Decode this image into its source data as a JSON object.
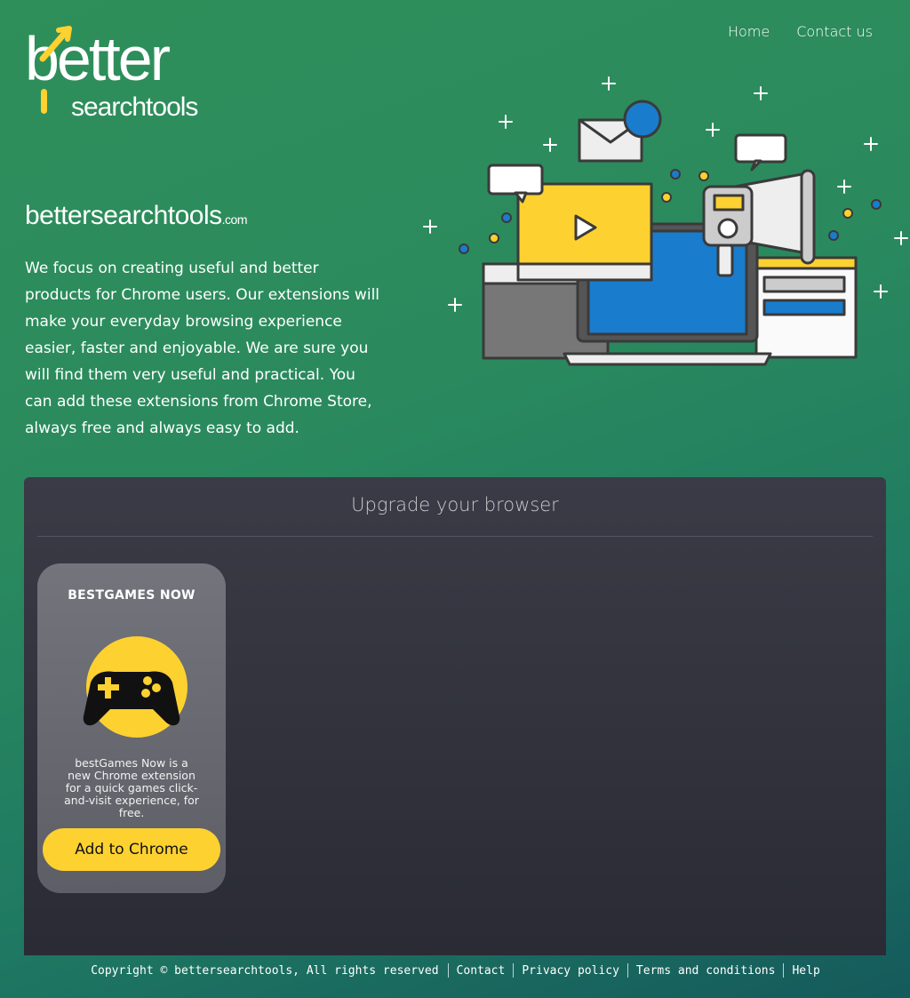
{
  "logo": {
    "top": "better",
    "bottom": "searchtools"
  },
  "nav": {
    "home": "Home",
    "contact": "Contact us"
  },
  "brand": {
    "name": "bettersearchtools",
    "tld": ".com"
  },
  "intro": "We focus on creating useful and better products for Chrome users. Our extensions will make your everyday browsing experience easier, faster and enjoyable. We are sure you will find them very useful and practical. You can add these extensions from Chrome Store, always free and always easy to add.",
  "panel": {
    "title": "Upgrade your browser"
  },
  "card": {
    "title": "BESTGAMES NOW",
    "icon": "gamepad-icon",
    "description": "bestGames Now is a new Chrome extension for a quick games click-and-visit experience, for free.",
    "button": "Add to Chrome"
  },
  "footer": {
    "copyright": "Copyright © bettersearchtools, All rights reserved",
    "links": [
      "Contact",
      "Privacy policy",
      "Terms and conditions",
      "Help"
    ]
  },
  "colors": {
    "accent": "#fdd130",
    "blue": "#1a7ccc",
    "panel": "#33343e",
    "card": "#6a6b73"
  }
}
